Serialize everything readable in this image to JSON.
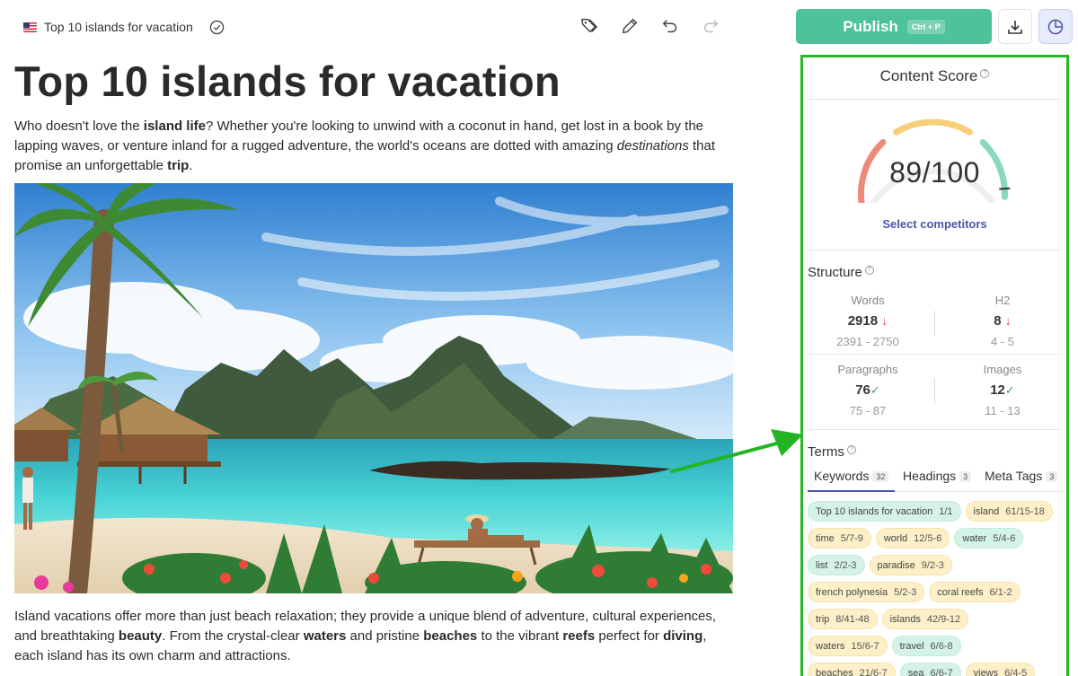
{
  "topbar": {
    "doc_title": "Top 10 islands for vacation",
    "icons": [
      "flag-us-icon",
      "check-circle-icon",
      "tags-icon",
      "pencil-icon",
      "undo-icon",
      "redo-icon"
    ]
  },
  "article": {
    "heading": "Top 10 islands for vacation",
    "intro": [
      {
        "t": "Who doesn't love the "
      },
      {
        "t": "island life",
        "b": true
      },
      {
        "t": "? Whether you're looking to unwind with a coconut in hand, get lost in a book by the lapping waves, or venture inland for a rugged adventure, the world's oceans are dotted with amazing "
      },
      {
        "t": "destinations",
        "i": true
      },
      {
        "t": " that promise an unforgettable "
      },
      {
        "t": "trip",
        "b": true
      },
      {
        "t": "."
      }
    ],
    "body": [
      {
        "t": "Island vacations offer more than just beach relaxation; they provide a unique blend of adventure, cultural experiences, and breathtaking "
      },
      {
        "t": "beauty",
        "b": true
      },
      {
        "t": ". From the crystal-clear "
      },
      {
        "t": "waters",
        "b": true
      },
      {
        "t": " and pristine "
      },
      {
        "t": "beaches",
        "b": true
      },
      {
        "t": " to the vibrant "
      },
      {
        "t": "reefs",
        "b": true
      },
      {
        "t": " perfect for "
      },
      {
        "t": "diving",
        "b": true
      },
      {
        "t": ", each island has its own charm and attractions."
      }
    ]
  },
  "publish": {
    "label": "Publish",
    "shortcut": "Ctrl + P"
  },
  "score_panel": {
    "title": "Content Score",
    "score_text": "89/100",
    "score": 89,
    "score_max": 100,
    "select_competitors": "Select competitors",
    "structure_title": "Structure",
    "stats": [
      {
        "label": "Words",
        "value": "2918",
        "range": "2391 - 2750",
        "status": "down"
      },
      {
        "label": "H2",
        "value": "8",
        "range": "4 - 5",
        "status": "down"
      },
      {
        "label": "Paragraphs",
        "value": "76",
        "range": "75 - 87",
        "status": "ok"
      },
      {
        "label": "Images",
        "value": "12",
        "range": "11 - 13",
        "status": "ok"
      }
    ],
    "status_glyphs": {
      "down": "↓",
      "ok": "✓"
    },
    "terms_title": "Terms",
    "tabs": [
      {
        "label": "Keywords",
        "count": "32"
      },
      {
        "label": "Headings",
        "count": "3"
      },
      {
        "label": "Meta Tags",
        "count": "3"
      }
    ],
    "keywords": [
      [
        {
          "term": "Top 10 islands for vacation",
          "value": "1/1",
          "color": "green"
        },
        {
          "term": "island",
          "value": "61/15-18",
          "color": "yellow"
        }
      ],
      [
        {
          "term": "time",
          "value": "5/7-9",
          "color": "yellow"
        },
        {
          "term": "world",
          "value": "12/5-6",
          "color": "yellow"
        },
        {
          "term": "water",
          "value": "5/4-6",
          "color": "green"
        }
      ],
      [
        {
          "term": "list",
          "value": "2/2-3",
          "color": "green"
        },
        {
          "term": "paradise",
          "value": "9/2-3",
          "color": "yellow"
        }
      ],
      [
        {
          "term": "french polynesia",
          "value": "5/2-3",
          "color": "yellow"
        },
        {
          "term": "coral reefs",
          "value": "6/1-2",
          "color": "yellow"
        }
      ],
      [
        {
          "term": "trip",
          "value": "8/41-48",
          "color": "yellow"
        },
        {
          "term": "islands",
          "value": "42/9-12",
          "color": "yellow"
        }
      ],
      [
        {
          "term": "waters",
          "value": "15/6-7",
          "color": "yellow"
        },
        {
          "term": "travel",
          "value": "6/6-8",
          "color": "green"
        }
      ],
      [
        {
          "term": "beaches",
          "value": "21/6-7",
          "color": "yellow"
        },
        {
          "term": "sea",
          "value": "6/6-7",
          "color": "green"
        },
        {
          "term": "views",
          "value": "6/4-5",
          "color": "yellow"
        }
      ]
    ]
  },
  "colors": {
    "publish_green": "#4ec29a",
    "panel_border": "#27b827",
    "link_blue": "#4a56a8",
    "gauge_red": "#ef8a7a",
    "gauge_yellow": "#f7cf7a",
    "gauge_green": "#8ad9bb"
  }
}
